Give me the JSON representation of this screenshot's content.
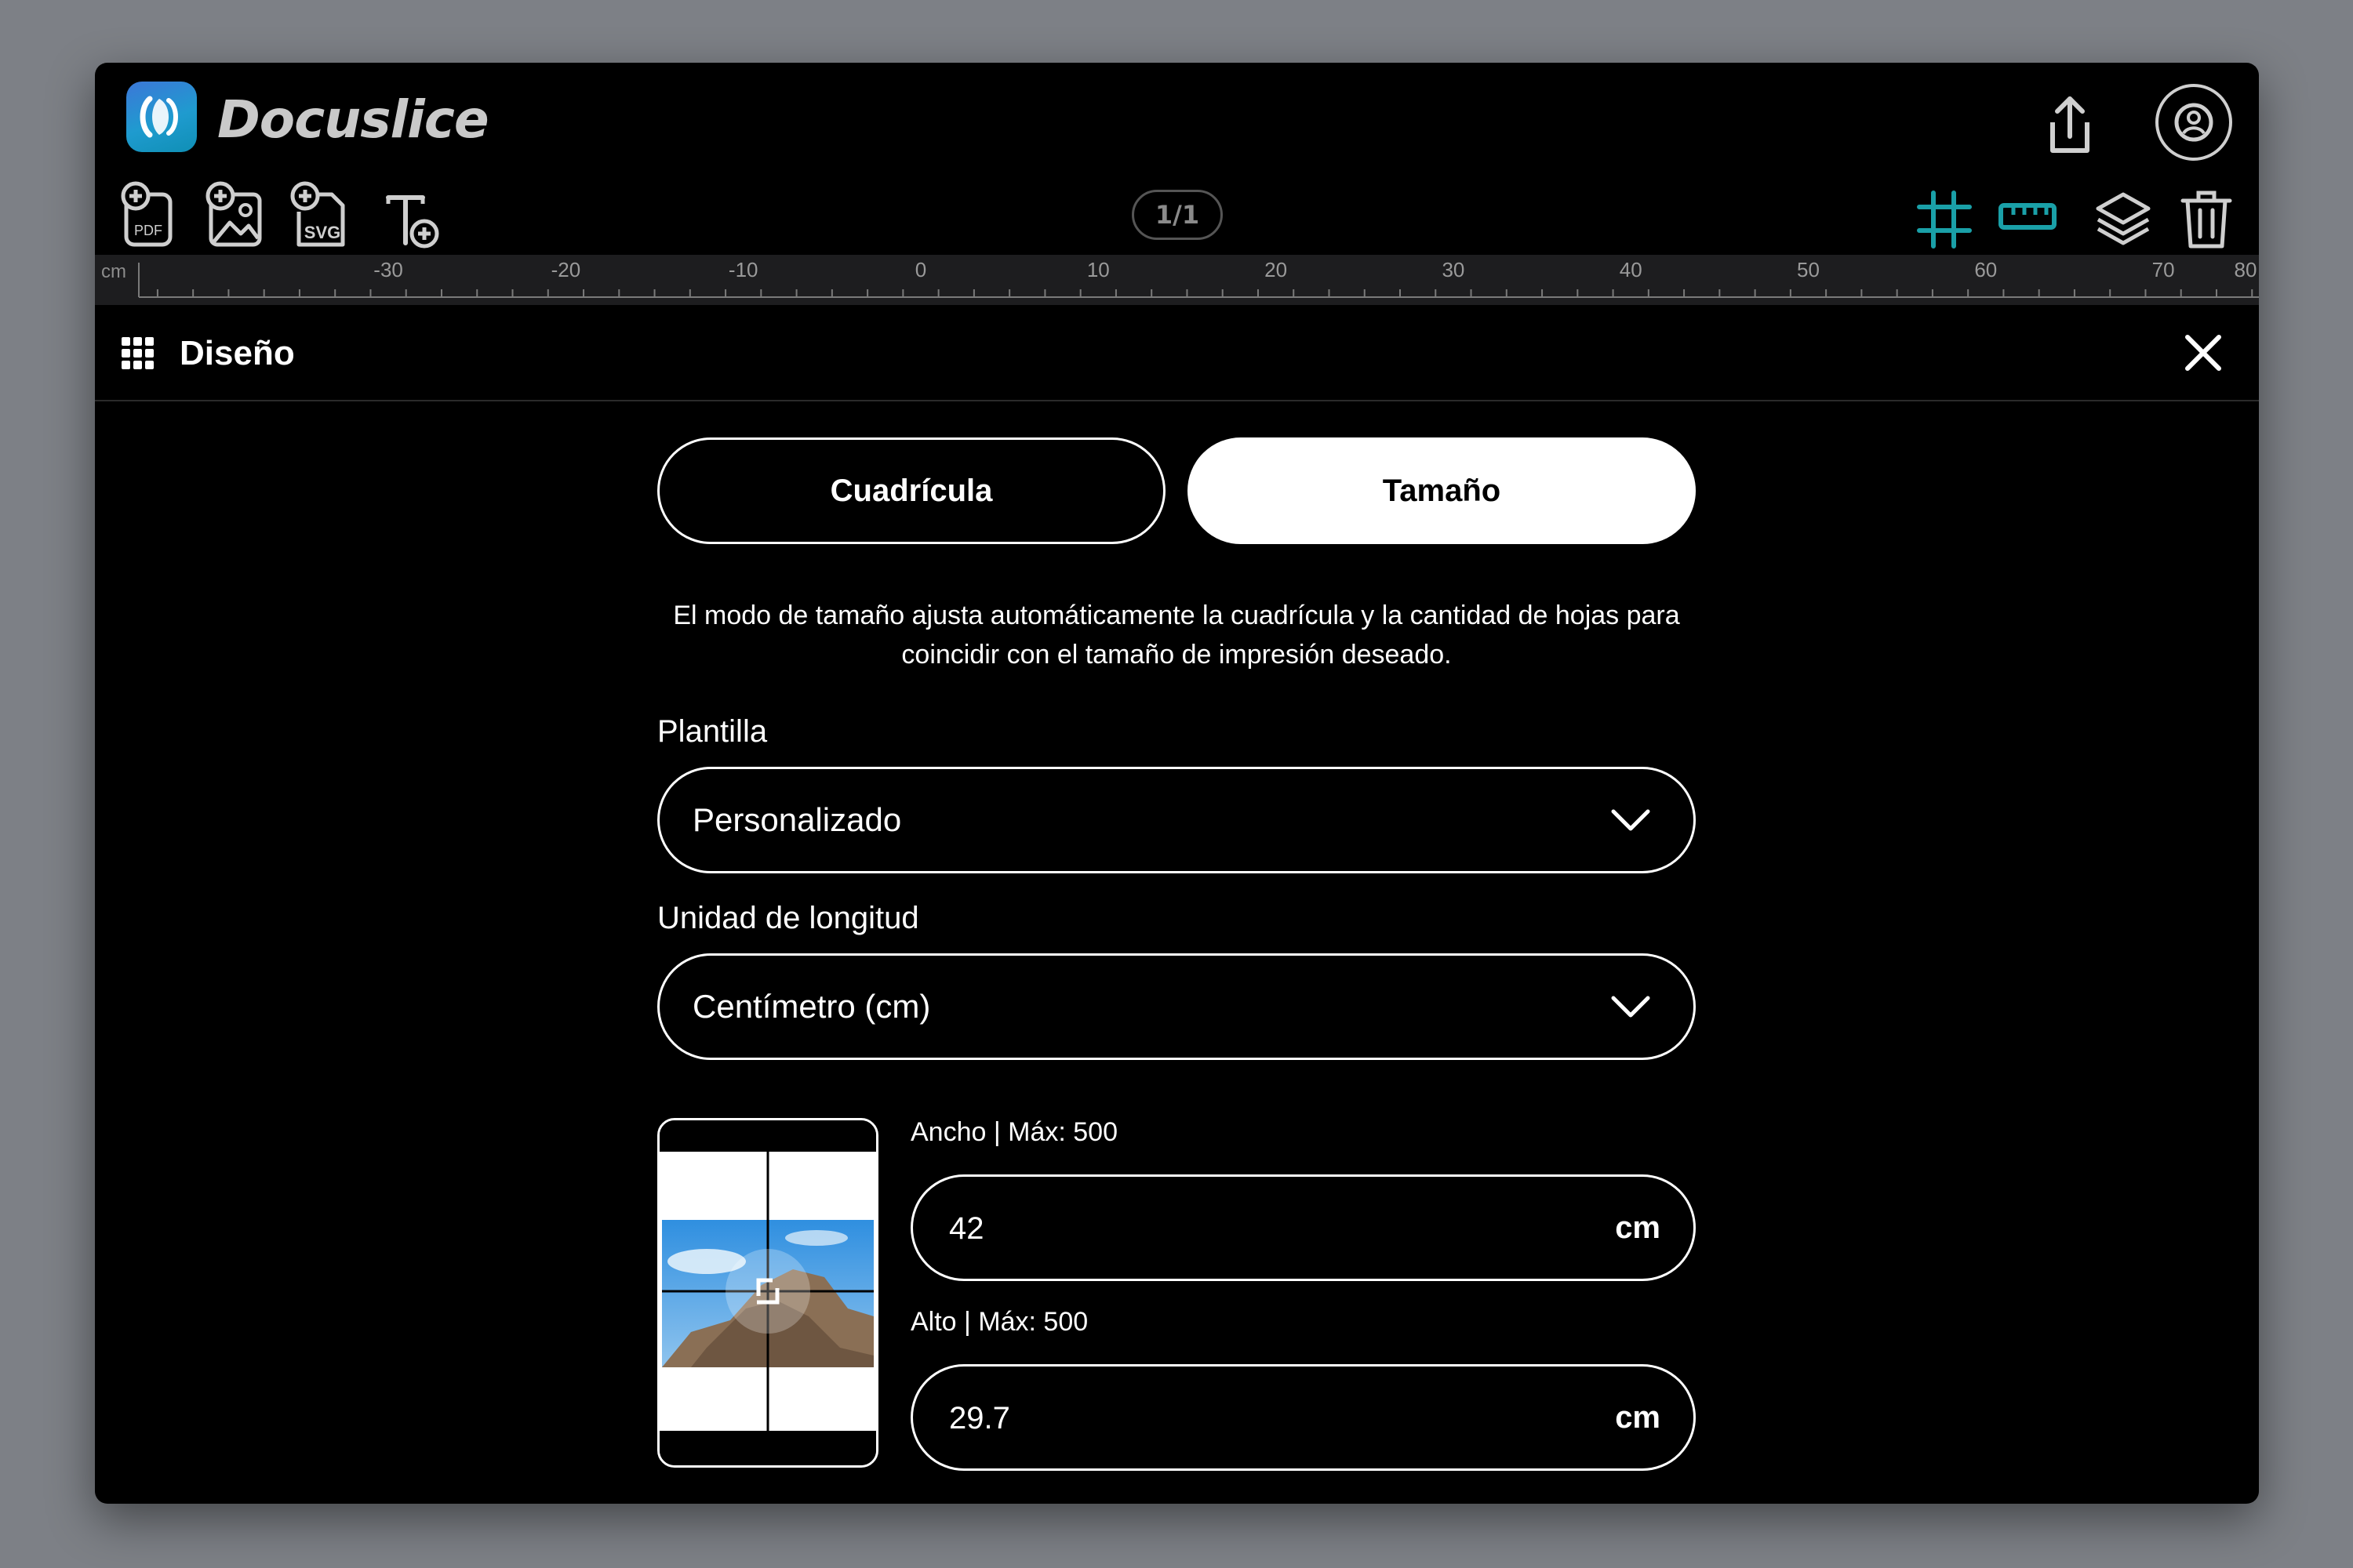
{
  "app": {
    "title": "Docuslice"
  },
  "toolbar": {
    "page_counter": "1/1"
  },
  "ruler": {
    "unit": "cm",
    "labels": [
      "-30",
      "-20",
      "-10",
      "0",
      "10",
      "20",
      "30",
      "40",
      "50",
      "60",
      "70",
      "80"
    ]
  },
  "panel": {
    "title": "Diseño",
    "tabs": [
      {
        "label": "Cuadrícula",
        "active": false
      },
      {
        "label": "Tamaño",
        "active": true
      }
    ],
    "description": "El modo de tamaño ajusta automáticamente la cuadrícula y la cantidad de hojas para coincidir con el tamaño de impresión deseado.",
    "template": {
      "label": "Plantilla",
      "value": "Personalizado"
    },
    "unit": {
      "label": "Unidad de longitud",
      "value": "Centímetro (cm)"
    },
    "width": {
      "label": "Ancho | Máx: 500",
      "value": "42",
      "unit": "cm"
    },
    "height": {
      "label": "Alto | Máx: 500",
      "value": "29.7",
      "unit": "cm"
    }
  },
  "colors": {
    "accent": "#1aa0a8",
    "background": "#000000",
    "ruler": "#1d1d1f"
  },
  "icons": [
    "share-icon",
    "account-icon",
    "add-pdf-icon",
    "add-image-icon",
    "add-svg-icon",
    "add-text-icon",
    "grid-icon",
    "ruler-icon",
    "layers-icon",
    "trash-icon",
    "close-icon",
    "chevron-down-icon",
    "rotate-icon"
  ]
}
